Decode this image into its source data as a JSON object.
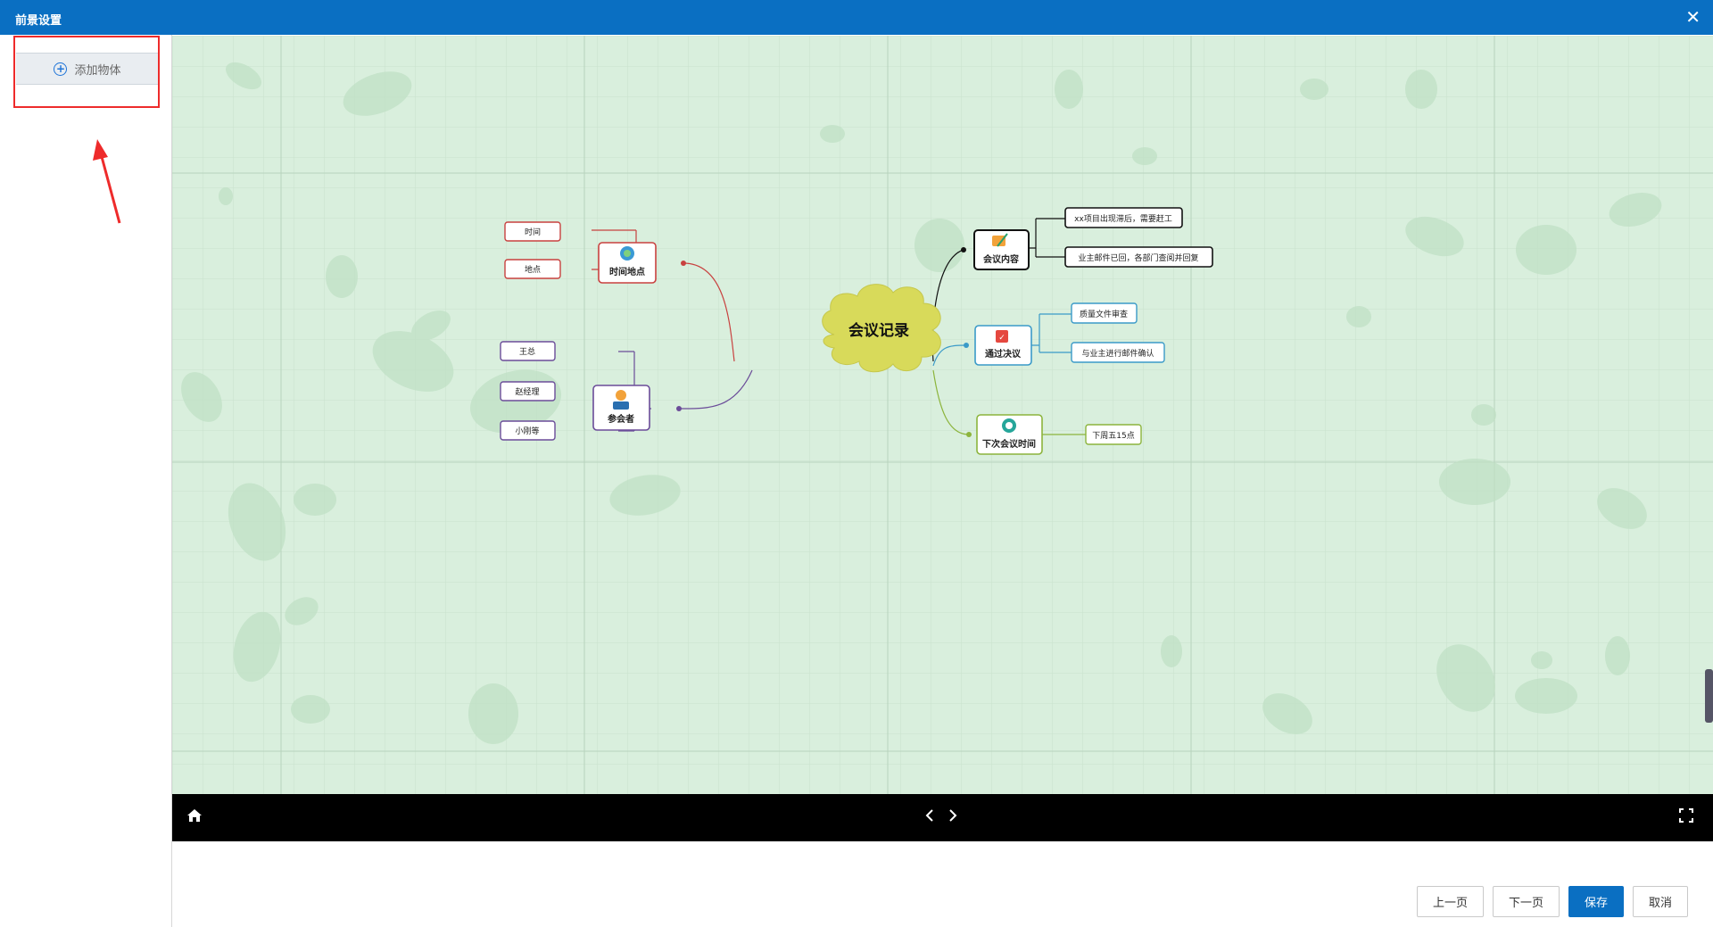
{
  "window": {
    "title": "前景设置"
  },
  "sidebar": {
    "add_object_label": "添加物体"
  },
  "mindmap": {
    "center": "会议记录",
    "left_branches": [
      {
        "label": "时间地点",
        "children": [
          "时间",
          "地点"
        ],
        "color": "#c8413f"
      },
      {
        "label": "参会者",
        "children": [
          "王总",
          "赵经理",
          "小刚等"
        ],
        "color": "#6b4c99"
      }
    ],
    "right_branches": [
      {
        "label": "会议内容",
        "children": [
          "xx项目出现滞后，需要赶工",
          "业主邮件已回，各部门查阅并回复"
        ],
        "color": "#111111"
      },
      {
        "label": "通过决议",
        "children": [
          "质量文件审查",
          "与业主进行邮件确认"
        ],
        "color": "#3a9ac8"
      },
      {
        "label": "下次会议时间",
        "children": [
          "下周五15点"
        ],
        "color": "#8cb43c"
      }
    ]
  },
  "footer": {
    "prev_label": "上一页",
    "next_label": "下一页",
    "save_label": "保存",
    "cancel_label": "取消"
  },
  "colors": {
    "accent": "#0a6fc2",
    "canvas_bg": "#d9efdd",
    "highlight": "#ee2b2b"
  }
}
